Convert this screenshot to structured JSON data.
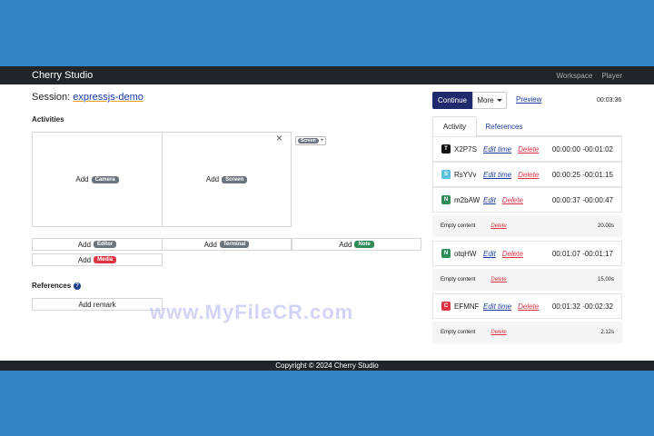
{
  "navbar": {
    "brand": "Cherry Studio",
    "links": [
      "Workspace",
      "Player"
    ]
  },
  "session": {
    "prefix": "Session: ",
    "name": "expressjs-demo"
  },
  "activities_section": {
    "title": "Activities",
    "add_label": "Add",
    "tiles": [
      "Camera",
      "Screen"
    ],
    "mini_badge": "Screen",
    "mini_plus": "+",
    "close_icon": "×",
    "buttons": [
      {
        "label": "Editor",
        "color": "#6c757d"
      },
      {
        "label": "Terminal",
        "color": "#6c757d"
      },
      {
        "label": "Note",
        "color": "#2e8b57"
      },
      {
        "label": "Media",
        "color": "#dc3545"
      }
    ]
  },
  "references_section": {
    "title": "References",
    "help_icon": "?",
    "add_remark": "Add remark"
  },
  "toolbar": {
    "continue": "Continue",
    "more": "More",
    "preview": "Preview",
    "timer": "00:03:36"
  },
  "tabs": [
    "Activity",
    "References"
  ],
  "activity_list": [
    {
      "icon": "T",
      "color": "#111111",
      "name": "X2P7S",
      "edit": "Edit time",
      "delete": "Delete",
      "time": "00:00:00 -00:01:02"
    },
    {
      "icon": "S",
      "color": "#5bc0de",
      "name": "RsYVv",
      "edit": "Edit time",
      "delete": "Delete",
      "time": "00:00:25 -00:01:15"
    },
    {
      "icon": "N",
      "color": "#2e8b57",
      "name": "m2bAW",
      "edit": "Edit",
      "delete": "Delete",
      "time": "00:00:37 -00:00:47"
    },
    {
      "icon": "N",
      "color": "#2e8b57",
      "name": "otqHW",
      "edit": "Edit",
      "delete": "Delete",
      "time": "00:01:07 -00:01:17"
    },
    {
      "icon": "C",
      "color": "#dc3545",
      "name": "EFMNF",
      "edit": "Edit time",
      "delete": "Delete",
      "time": "00:01:32 -00:02:32"
    }
  ],
  "sub_rows": [
    {
      "content": "Empty content",
      "delete": "Delete",
      "duration": "20.00s"
    },
    {
      "content": "Empty content",
      "delete": "Delete",
      "duration": "15.00s"
    },
    {
      "content": "Empty content",
      "delete": "Delete",
      "duration": "2.12s"
    }
  ],
  "watermark": "www.MyFileCR.com",
  "footer": "Copyright © 2024 Cherry Studio"
}
